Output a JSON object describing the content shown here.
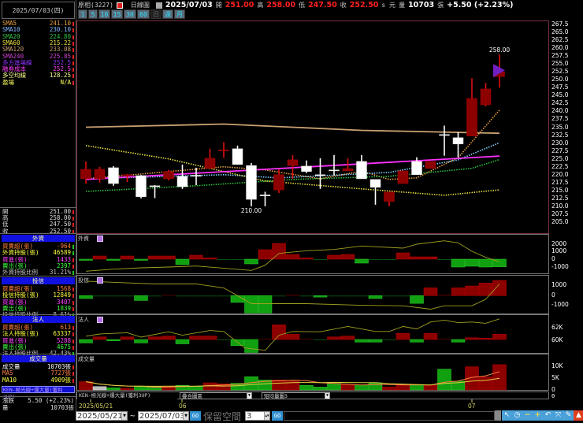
{
  "left": {
    "date": "2025/07/03(四)",
    "ma_rows": [
      {
        "label": "SMA5",
        "value": "241.10",
        "color": "#e8a040"
      },
      {
        "label": "SMA10",
        "value": "230.10",
        "color": "#80b8ff"
      },
      {
        "label": "SMA20",
        "value": "224.80",
        "color": "#30c040"
      },
      {
        "label": "SMA60",
        "value": "215.22",
        "color": "#e8e040"
      },
      {
        "label": "SMA120",
        "value": "233.08",
        "color": "#c8a070"
      },
      {
        "label": "SMA240",
        "value": "225.85",
        "color": "#d040d0"
      },
      {
        "label": "多方進場線",
        "value": "252.5",
        "color": "#9030ff"
      },
      {
        "label": "融券成本",
        "value": "252.5",
        "color": "#ff40ff"
      },
      {
        "label": "多空均線",
        "value": "128.25",
        "color": "#ffff90"
      },
      {
        "label": "盈場",
        "value": "N/A",
        "color": "#ffff60"
      }
    ],
    "ohlc_rows": [
      {
        "label": "開",
        "value": "251.00"
      },
      {
        "label": "高",
        "value": "258.00"
      },
      {
        "label": "低",
        "value": "247.50"
      },
      {
        "label": "收",
        "value": "252.50"
      }
    ],
    "foreign": {
      "title": "外資",
      "rows": [
        {
          "label": "買賣超(張)",
          "value": "-964",
          "color": "#ff8040"
        },
        {
          "label": "外資持股(張)",
          "value": "46589",
          "color": "#ffff40"
        },
        {
          "label": "買進(張)",
          "value": "1433",
          "color": "#ff40ff"
        },
        {
          "label": "賣出(張)",
          "value": "2397",
          "color": "#40ff40"
        },
        {
          "label": "外資持股比例",
          "value": "31.21%",
          "color": "#c0c0c0"
        }
      ]
    },
    "trust": {
      "title": "投信",
      "rows": [
        {
          "label": "買賣超(張)",
          "value": "1568",
          "color": "#ff8040"
        },
        {
          "label": "投信持股(張)",
          "value": "12849",
          "color": "#ffff40"
        },
        {
          "label": "買進(張)",
          "value": "3407",
          "color": "#ff40ff"
        },
        {
          "label": "賣出(張)",
          "value": "1839",
          "color": "#40ff40"
        },
        {
          "label": "投信持股比例",
          "value": "8.61%",
          "color": "#c0c0c0"
        }
      ]
    },
    "institutional": {
      "title": "法人",
      "rows": [
        {
          "label": "買賣超(張)",
          "value": "613",
          "color": "#ff8040"
        },
        {
          "label": "法人持股(張)",
          "value": "63337",
          "color": "#ffff40"
        },
        {
          "label": "買進(張)",
          "value": "5288",
          "color": "#ff40ff"
        },
        {
          "label": "賣出(張)",
          "value": "4675",
          "color": "#40ff40"
        },
        {
          "label": "法人持股比例",
          "value": "42.43%",
          "color": "#c0c0c0"
        }
      ]
    },
    "volume": {
      "title": "成交量",
      "rows": [
        {
          "label": "成交量",
          "value": "10703張",
          "color": "#ffffff"
        },
        {
          "label": "MA5",
          "value": "7727張",
          "color": "#ff8040"
        },
        {
          "label": "MA10",
          "value": "4909張",
          "color": "#ffff40"
        }
      ]
    },
    "strategy": "KEN-極光線+爆大量(獲利3UP)",
    "change_label": "漲跌",
    "change_value": "5.50 (+2.23%)",
    "vol_label": "量",
    "vol_value": "10703張"
  },
  "header": {
    "stock": "原相(3227)",
    "chart_type": "日線圖",
    "date": "2025/07/03",
    "open_label": "開",
    "open": "251.00",
    "high_label": "高",
    "high": "258.00",
    "low_label": "低",
    "low": "247.50",
    "close_label": "收",
    "close": "252.50",
    "unit": "s 元",
    "vol_label": "量",
    "vol": "10703",
    "vol_unit": "張",
    "change": "+5.50 (+2.23%)",
    "periods": [
      "1",
      "5",
      "10",
      "15",
      "30",
      "60",
      "日",
      "週",
      "月"
    ],
    "active_period": "日"
  },
  "bottom": {
    "overlay_select": "疊合圖區",
    "ma_select": "短均量圖3",
    "x_labels": [
      "2025/05/21",
      "06",
      "07"
    ],
    "start_date": "2025/05/21",
    "tilde": "~",
    "end_date": "2025/07/03",
    "go": "GO",
    "reserve_label": "保留空間",
    "reserve_value": "3",
    "tools": [
      "arrow-icon",
      "clock-icon",
      "zoom-out-icon",
      "zoom-in-icon",
      "undo-icon",
      "fit-icon",
      "pen-icon",
      "bell-icon"
    ]
  },
  "chart_data": [
    {
      "type": "candlestick",
      "ylim": [
        205.0,
        267.5
      ],
      "y_ticks": [
        "267.5",
        "265.0",
        "262.5",
        "260.0",
        "257.5",
        "255.0",
        "252.5",
        "250.0",
        "247.5",
        "245.0",
        "242.5",
        "240.0",
        "237.5",
        "235.0",
        "232.5",
        "230.0",
        "227.5",
        "225.0",
        "222.5",
        "220.0",
        "217.5",
        "215.0",
        "212.5",
        "210.0",
        "207.5",
        "205.0"
      ],
      "x_ticks": [
        "2025/05/21",
        "06",
        "07"
      ],
      "ohlc": [
        [
          218.7,
          224.2,
          217.2,
          221.7
        ],
        [
          218.7,
          222.5,
          217.5,
          221.7
        ],
        [
          222.2,
          222.7,
          216.5,
          217.2
        ],
        [
          219.7,
          220.2,
          217.7,
          220.0
        ],
        [
          219.7,
          219.9,
          212.5,
          213.0
        ],
        [
          216.5,
          216.7,
          212.6,
          216.2
        ],
        [
          218.7,
          221.5,
          218.2,
          221.0
        ],
        [
          219.5,
          223.2,
          215.5,
          216.2
        ],
        [
          219.8,
          222.2,
          216.7,
          219.5
        ],
        [
          222.0,
          228.2,
          222.0,
          225.2
        ],
        [
          227.5,
          230.3,
          225.3,
          227.8
        ],
        [
          228.2,
          229.2,
          223.2,
          223.2
        ],
        [
          222.9,
          223.7,
          210.0,
          212.2
        ],
        [
          213.6,
          214.6,
          210.0,
          213.4
        ],
        [
          215.2,
          221.7,
          214.2,
          220.0
        ],
        [
          222.9,
          226.2,
          218.7,
          224.7
        ],
        [
          222.7,
          224.5,
          220.5,
          221.0
        ],
        [
          220.0,
          225.2,
          215.5,
          219.7
        ],
        [
          221.5,
          226.2,
          219.7,
          221.4
        ],
        [
          221.2,
          225.2,
          221.2,
          221.9
        ],
        [
          224.2,
          226.2,
          218.7,
          218.7
        ],
        [
          218.5,
          218.5,
          210.5,
          216.0
        ],
        [
          211.5,
          214.5,
          210.0,
          214.5
        ],
        [
          217.2,
          221.2,
          217.2,
          221.2
        ],
        [
          224.2,
          225.5,
          220.0,
          220.0
        ],
        [
          222.0,
          224.2,
          222.0,
          224.2
        ],
        [
          232.7,
          235.5,
          226.0,
          232.4
        ],
        [
          231.7,
          233.5,
          225.5,
          229.7
        ],
        [
          232.2,
          250.5,
          232.2,
          244.1
        ],
        [
          242.1,
          249.0,
          241.6,
          247.1
        ],
        [
          251.0,
          258.0,
          247.5,
          252.5
        ]
      ],
      "annotations": [
        {
          "index": 12,
          "text": "210.00"
        },
        {
          "index": 30,
          "text": "258.00"
        }
      ],
      "ma_lines": [
        {
          "name": "SMA5",
          "color": "#e8a040",
          "dotted": true,
          "points": [
            [
              0,
              218.7
            ],
            [
              10,
              222.5
            ],
            [
              13,
              221.5
            ],
            [
              17,
              218.7
            ],
            [
              20,
              221.1
            ],
            [
              22,
              218.5
            ],
            [
              24,
              219.0
            ],
            [
              27,
              225.4
            ],
            [
              30,
              240.4
            ]
          ]
        },
        {
          "name": "SMA10",
          "color": "#80d0ff",
          "dotted": true,
          "points": [
            [
              0,
              218.7
            ],
            [
              10,
              220.0
            ],
            [
              14,
              219.0
            ],
            [
              22,
              220.7
            ],
            [
              27,
              224.7
            ],
            [
              30,
              230.1
            ]
          ]
        },
        {
          "name": "SMA20",
          "color": "#30c040",
          "dotted": true,
          "points": [
            [
              0,
              214.7
            ],
            [
              8,
              216.5
            ],
            [
              15,
              218.5
            ],
            [
              22,
              219.5
            ],
            [
              28,
              222.0
            ],
            [
              30,
              224.8
            ]
          ]
        },
        {
          "name": "SMA60",
          "color": "#e8e040",
          "dotted": true,
          "points": [
            [
              0,
              229.2
            ],
            [
              6,
              225.0
            ],
            [
              13,
              218.0
            ],
            [
              20,
              215.5
            ],
            [
              26,
              213.5
            ],
            [
              30,
              215.2
            ]
          ]
        },
        {
          "name": "SMA120",
          "color": "#c8a070",
          "dotted": false,
          "points": [
            [
              0,
              235.0
            ],
            [
              10,
              236.0
            ],
            [
              20,
              234.0
            ],
            [
              30,
              233.1
            ]
          ]
        },
        {
          "name": "SMA240",
          "color": "#ff30ff",
          "dotted": false,
          "points": [
            [
              0,
              218.5
            ],
            [
              30,
              225.9
            ]
          ]
        }
      ]
    },
    {
      "type": "bar+line",
      "title": "外資",
      "y_ticks": [
        "2000",
        "1000",
        "0",
        "-1000"
      ],
      "bars": [
        -150,
        400,
        -150,
        400,
        -150,
        400,
        400,
        -700,
        500,
        150,
        -50,
        -100,
        -600,
        1200,
        2000,
        600,
        150,
        -30,
        500,
        600,
        -500,
        -30,
        -50,
        800,
        300,
        300,
        -50,
        -1000,
        -900,
        -1000,
        -964
      ],
      "line": [
        [
          0,
          -1530
        ],
        [
          2,
          -1270
        ],
        [
          4,
          -1100
        ],
        [
          6,
          -1000
        ],
        [
          8,
          -870
        ],
        [
          12,
          -1430
        ],
        [
          13,
          -770
        ],
        [
          14,
          730
        ],
        [
          16,
          1070
        ],
        [
          18,
          1230
        ],
        [
          20,
          1670
        ],
        [
          23,
          1400
        ],
        [
          24,
          1900
        ],
        [
          26,
          2330
        ],
        [
          27,
          2070
        ],
        [
          28,
          1000
        ],
        [
          29,
          230
        ],
        [
          30,
          -330
        ]
      ]
    },
    {
      "type": "bar+line",
      "title": "投信",
      "y_ticks": [
        "1000",
        "0",
        "-1000"
      ],
      "bars": [
        -300,
        -50,
        -50,
        -50,
        -500,
        -50,
        50,
        -50,
        -30,
        -30,
        -50,
        -700,
        -1800,
        -1800,
        -50,
        100,
        -50,
        -150,
        -50,
        -50,
        -10,
        -300,
        -50,
        -10,
        -800,
        800,
        100,
        800,
        1000,
        1300,
        1568
      ],
      "line": [
        [
          0,
          1500
        ],
        [
          5,
          1200
        ],
        [
          8,
          1200
        ],
        [
          10,
          800
        ],
        [
          11,
          0
        ],
        [
          12,
          -830
        ],
        [
          16,
          -830
        ],
        [
          20,
          -1000
        ],
        [
          23,
          -1050
        ],
        [
          25,
          -1400
        ],
        [
          26,
          -1050
        ],
        [
          28,
          -1050
        ],
        [
          29,
          -370
        ],
        [
          30,
          1200
        ]
      ]
    },
    {
      "type": "bar+line",
      "title": "法人",
      "y_ticks": [
        "62K",
        "60K"
      ],
      "bars": [
        -400,
        300,
        -150,
        300,
        -400,
        300,
        400,
        -500,
        400,
        400,
        -80,
        -700,
        -1500,
        50,
        1700,
        600,
        50,
        -50,
        300,
        400,
        -300,
        -300,
        -50,
        700,
        -300,
        700,
        30,
        -300,
        200,
        150,
        613
      ],
      "line_unit": "K",
      "line": [
        [
          0,
          60.65
        ],
        [
          1,
          61.0
        ],
        [
          3,
          61.2
        ],
        [
          4,
          60.5
        ],
        [
          6,
          61.35
        ],
        [
          7,
          60.8
        ],
        [
          9,
          61.55
        ],
        [
          10,
          61.4
        ],
        [
          11.5,
          58.8
        ],
        [
          13,
          58.4
        ],
        [
          14,
          60.8
        ],
        [
          15,
          61.4
        ],
        [
          17,
          61.35
        ],
        [
          19,
          62.2
        ],
        [
          21,
          61.4
        ],
        [
          22,
          61.4
        ],
        [
          23,
          62.2
        ],
        [
          24,
          61.8
        ],
        [
          25,
          62.9
        ],
        [
          26,
          63.2
        ],
        [
          27,
          62.8
        ],
        [
          28,
          62.9
        ],
        [
          29,
          62.7
        ],
        [
          30,
          63.4
        ]
      ]
    },
    {
      "type": "bar+line",
      "title": "成交量",
      "y_ticks": [
        "10K",
        "5K",
        "0"
      ],
      "volumes_k": [
        3.5,
        1.4,
        0.9,
        0.7,
        1.4,
        1.4,
        1.6,
        1.9,
        1.4,
        3.0,
        2.6,
        2.8,
        5.6,
        4.2,
        4.2,
        3.7,
        1.9,
        1.2,
        2.8,
        2.3,
        2.1,
        3.0,
        1.2,
        2.1,
        2.3,
        1.9,
        8.8,
        3.7,
        9.8,
        5.6,
        10.7
      ],
      "ma_colors": {
        "MA5": "#ff8040",
        "MA10": "#e0d040"
      }
    }
  ]
}
